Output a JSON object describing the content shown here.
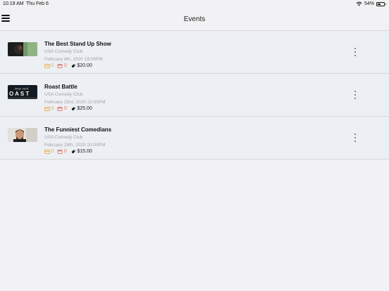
{
  "status_bar": {
    "time": "10:19 AM",
    "date": "Thu Feb 6",
    "battery": "54%",
    "battery_level": 0.54
  },
  "nav": {
    "title": "Events"
  },
  "events": [
    {
      "title": "The Best Stand Up Show",
      "venue": "USA Comedy Club",
      "datetime": "February 8th, 2020 19:00PM",
      "tickets": "0",
      "bookings": "0",
      "price": "$20.00"
    },
    {
      "title": "Roast Battle",
      "venue": "USA Comedy Club",
      "datetime": "February 23rd, 2020 22:00PM",
      "tickets": "0",
      "bookings": "0",
      "price": "$25.00",
      "thumb_text": "New York"
    },
    {
      "title": "The Funniest Comedians",
      "venue": "USA Comedy Club",
      "datetime": "February 28th, 2020 20:00PM",
      "tickets": "0",
      "bookings": "0",
      "price": "$15.00"
    }
  ],
  "colors": {
    "ticket": "#f2b040",
    "booking": "#e07b6b",
    "row_bg": "#eceff4",
    "page_bg": "#f2f2f4"
  }
}
